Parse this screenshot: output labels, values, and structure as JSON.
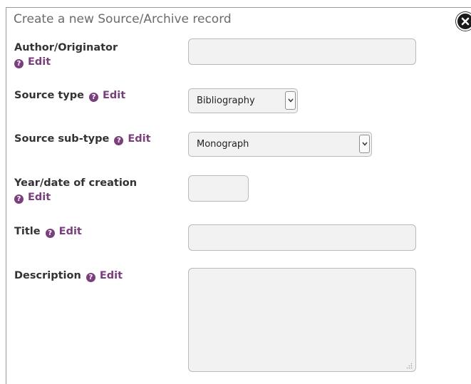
{
  "dialog": {
    "title": "Create a new Source/Archive record"
  },
  "fields": {
    "author": {
      "label": "Author/Originator",
      "help": "?",
      "edit": "Edit",
      "value": ""
    },
    "source_type": {
      "label": "Source type",
      "help": "?",
      "edit": "Edit",
      "selected": "Bibliography"
    },
    "source_subtype": {
      "label": "Source sub-type",
      "help": "?",
      "edit": "Edit",
      "selected": "Monograph"
    },
    "year": {
      "label": "Year/date of creation",
      "help": "?",
      "edit": "Edit",
      "value": ""
    },
    "title": {
      "label": "Title",
      "help": "?",
      "edit": "Edit",
      "value": ""
    },
    "description": {
      "label": "Description",
      "help": "?",
      "edit": "Edit",
      "value": ""
    }
  },
  "icons": {
    "close": "close-icon",
    "help": "help-icon",
    "dropdown": "chevron-down-icon"
  },
  "colors": {
    "accent": "#7a3f7d",
    "field_bg": "#f2f2f2",
    "field_border": "#b9b9b9",
    "title_text": "#6b6b6b"
  }
}
